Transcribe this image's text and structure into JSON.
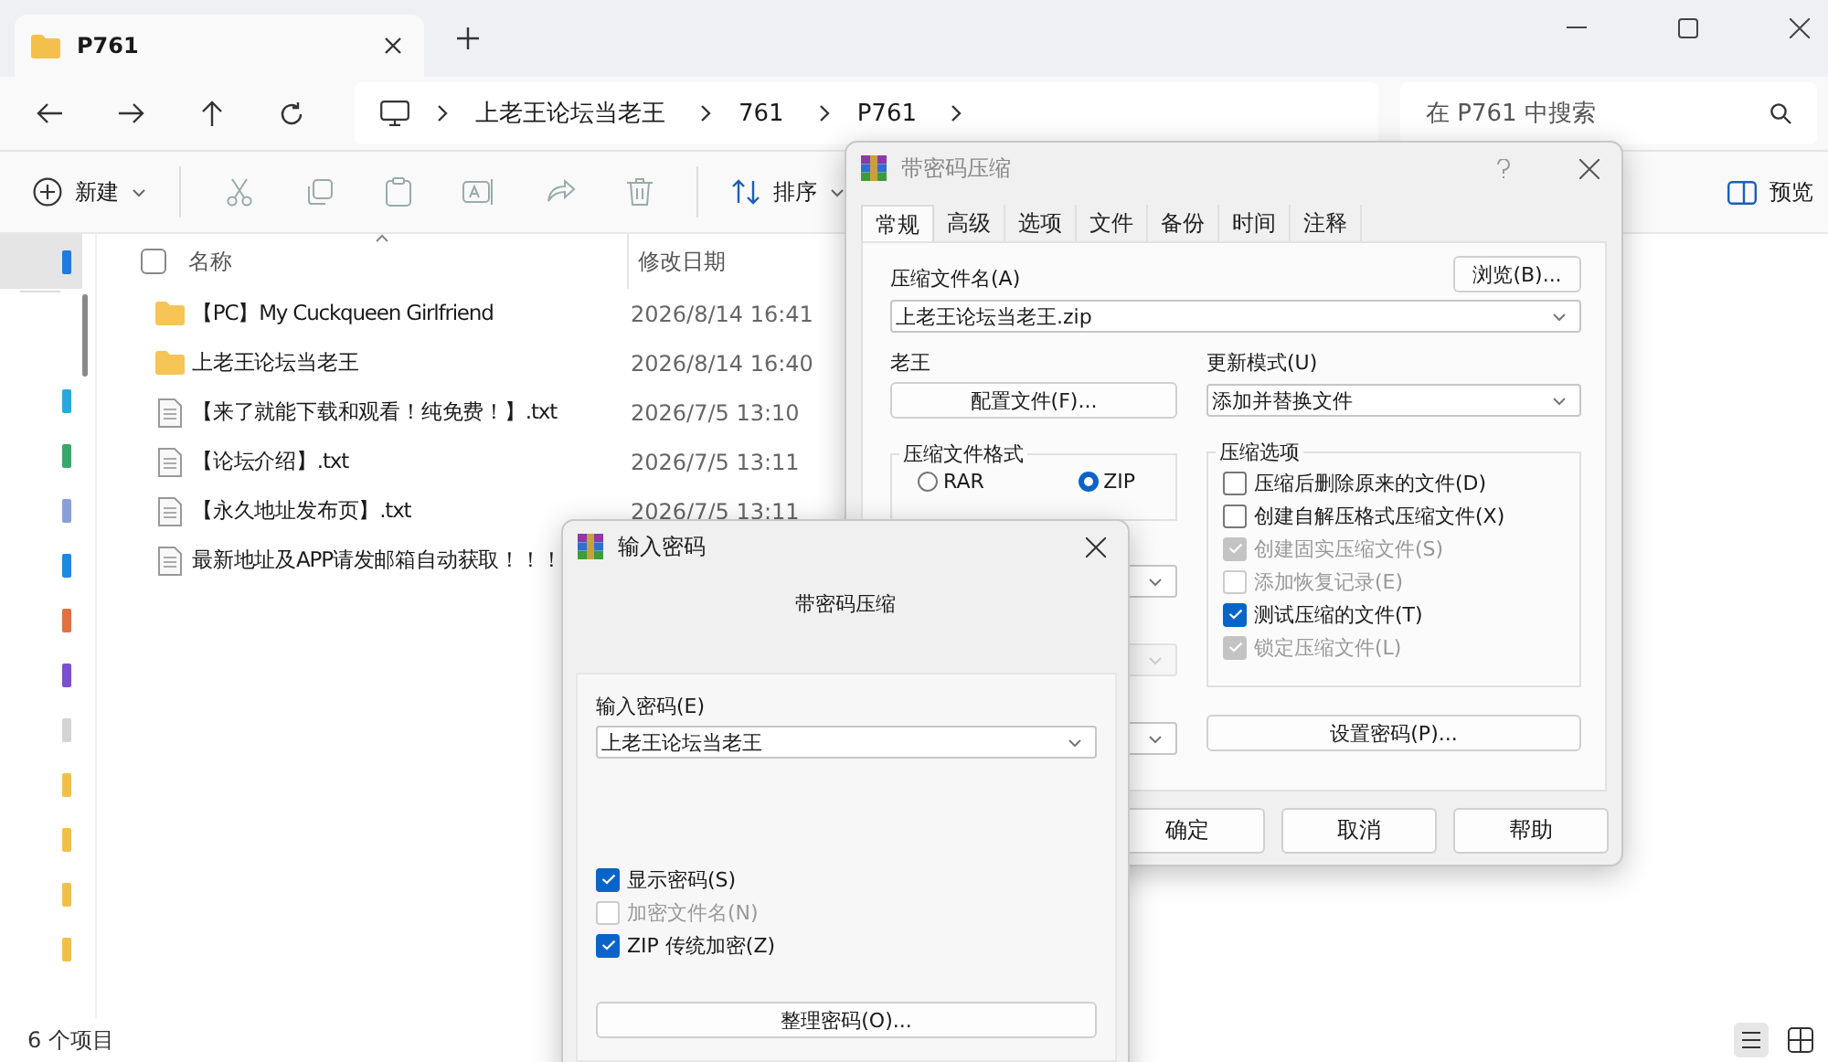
{
  "explorer": {
    "tab": {
      "title": "P761"
    },
    "breadcrumb": [
      "上老王论坛当老王",
      "761",
      "P761"
    ],
    "search": {
      "placeholder": "在 P761 中搜索"
    },
    "toolbar": {
      "new": "新建",
      "sort": "排序",
      "preview": "预览"
    },
    "nav_items": [
      {
        "selected": true,
        "color": "#1e7be0"
      },
      {
        "selected": false,
        "color": "#29a8e0"
      },
      {
        "selected": false,
        "color": "#3aa76d"
      },
      {
        "selected": false,
        "color": "#8aa0d8"
      },
      {
        "selected": false,
        "color": "#1e88e5"
      },
      {
        "selected": false,
        "color": "#e07040"
      },
      {
        "selected": false,
        "color": "#7b4fd0"
      },
      {
        "selected": false,
        "color": "#d4d4d4"
      },
      {
        "selected": false,
        "color": "#f2c04a"
      },
      {
        "selected": false,
        "color": "#f2c04a"
      },
      {
        "selected": false,
        "color": "#f2c04a"
      },
      {
        "selected": false,
        "color": "#f2c04a"
      }
    ],
    "select_all": {
      "checked": false
    },
    "columns": [
      "名称",
      "修改日期"
    ],
    "files": [
      {
        "kind": "folder",
        "name": "【PC】My Cuckqueen Girlfriend",
        "modified": "2026/8/14 16:41"
      },
      {
        "kind": "folder",
        "name": "上老王论坛当老王",
        "modified": "2026/8/14 16:40"
      },
      {
        "kind": "text",
        "name": "【来了就能下载和观看！纯免费！】.txt",
        "modified": "2026/7/5 13:10"
      },
      {
        "kind": "text",
        "name": "【论坛介绍】.txt",
        "modified": "2026/7/5 13:11"
      },
      {
        "kind": "text",
        "name": "【永久地址发布页】.txt",
        "modified": "2026/7/5 13:11"
      },
      {
        "kind": "text",
        "name": "最新地址及APP请发邮箱自动获取！！！"
      }
    ],
    "status": "6 个项目"
  },
  "archive_dialog": {
    "title": "带密码压缩",
    "tabs": [
      {
        "label": "常规",
        "selected": true
      },
      {
        "label": "高级",
        "selected": false
      },
      {
        "label": "选项",
        "selected": false
      },
      {
        "label": "文件",
        "selected": false
      },
      {
        "label": "备份",
        "selected": false
      },
      {
        "label": "时间",
        "selected": false
      },
      {
        "label": "注释",
        "selected": false
      }
    ],
    "archive_name_label": "压缩文件名(A)",
    "browse_button": "浏览(B)...",
    "archive_name": "上老王论坛当老王.zip",
    "profile_label": "老王",
    "profile_button": "配置文件(F)...",
    "update_mode_label": "更新模式(U)",
    "update_mode": "添加并替换文件",
    "format_label": "压缩文件格式",
    "formats": [
      {
        "label": "RAR",
        "selected": false
      },
      {
        "label": "ZIP",
        "selected": true
      }
    ],
    "options_label": "压缩选项",
    "options": [
      {
        "label": "压缩后删除原来的文件(D)",
        "checked": false,
        "disabled": false
      },
      {
        "label": "创建自解压格式压缩文件(X)",
        "checked": false,
        "disabled": false
      },
      {
        "label": "创建固实压缩文件(S)",
        "checked": true,
        "disabled": true
      },
      {
        "label": "添加恢复记录(E)",
        "checked": false,
        "disabled": true
      },
      {
        "label": "测试压缩的文件(T)",
        "checked": true,
        "disabled": false
      },
      {
        "label": "锁定压缩文件(L)",
        "checked": true,
        "disabled": true
      }
    ],
    "combos": [
      {
        "disabled": false
      },
      {
        "disabled": true
      },
      {
        "disabled": false
      }
    ],
    "set_password_button": "设置密码(P)...",
    "buttons": [
      "确定",
      "取消",
      "帮助"
    ]
  },
  "password_dialog": {
    "title": "输入密码",
    "subtitle": "带密码压缩",
    "password_label": "输入密码(E)",
    "password": "上老王论坛当老王",
    "options": [
      {
        "label": "显示密码(S)",
        "checked": true,
        "disabled": false
      },
      {
        "label": "加密文件名(N)",
        "checked": false,
        "disabled": true
      },
      {
        "label": "ZIP 传统加密(Z)",
        "checked": true,
        "disabled": false
      }
    ],
    "organize_button": "整理密码(O)..."
  }
}
